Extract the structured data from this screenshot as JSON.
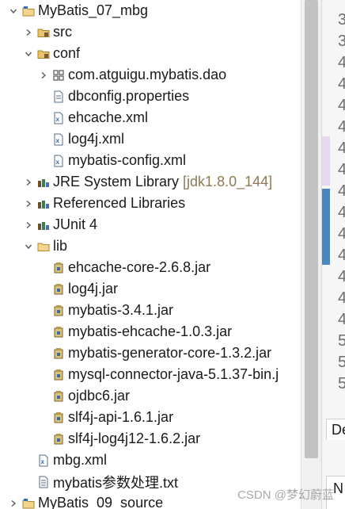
{
  "tree": [
    {
      "label": "MyBatis_07_mbg",
      "icon": "project-icon",
      "toggle": "expanded",
      "depth": 0
    },
    {
      "label": "src",
      "icon": "source-folder-icon",
      "toggle": "collapsed",
      "depth": 1
    },
    {
      "label": "conf",
      "icon": "source-folder-icon",
      "toggle": "expanded",
      "depth": 1
    },
    {
      "label": "com.atguigu.mybatis.dao",
      "icon": "package-icon",
      "toggle": "collapsed",
      "depth": 2
    },
    {
      "label": "dbconfig.properties",
      "icon": "properties-file-icon",
      "toggle": "none",
      "depth": 2
    },
    {
      "label": "ehcache.xml",
      "icon": "xml-file-icon",
      "toggle": "none",
      "depth": 2
    },
    {
      "label": "log4j.xml",
      "icon": "xml-file-icon",
      "toggle": "none",
      "depth": 2
    },
    {
      "label": "mybatis-config.xml",
      "icon": "xml-file-icon",
      "toggle": "none",
      "depth": 2
    },
    {
      "label": "JRE System Library",
      "decoration": "[jdk1.8.0_144]",
      "icon": "library-icon",
      "toggle": "collapsed",
      "depth": 1
    },
    {
      "label": "Referenced Libraries",
      "icon": "library-icon",
      "toggle": "collapsed",
      "depth": 1
    },
    {
      "label": "JUnit 4",
      "icon": "library-icon",
      "toggle": "collapsed",
      "depth": 1
    },
    {
      "label": "lib",
      "icon": "folder-icon",
      "toggle": "expanded",
      "depth": 1
    },
    {
      "label": "ehcache-core-2.6.8.jar",
      "icon": "jar-icon",
      "toggle": "none",
      "depth": 2
    },
    {
      "label": "log4j.jar",
      "icon": "jar-icon",
      "toggle": "none",
      "depth": 2
    },
    {
      "label": "mybatis-3.4.1.jar",
      "icon": "jar-icon",
      "toggle": "none",
      "depth": 2
    },
    {
      "label": "mybatis-ehcache-1.0.3.jar",
      "icon": "jar-icon",
      "toggle": "none",
      "depth": 2
    },
    {
      "label": "mybatis-generator-core-1.3.2.jar",
      "icon": "jar-icon",
      "toggle": "none",
      "depth": 2
    },
    {
      "label": "mysql-connector-java-5.1.37-bin.j",
      "icon": "jar-icon",
      "toggle": "none",
      "depth": 2
    },
    {
      "label": "ojdbc6.jar",
      "icon": "jar-icon",
      "toggle": "none",
      "depth": 2
    },
    {
      "label": "slf4j-api-1.6.1.jar",
      "icon": "jar-icon",
      "toggle": "none",
      "depth": 2
    },
    {
      "label": "slf4j-log4j12-1.6.2.jar",
      "icon": "jar-icon",
      "toggle": "none",
      "depth": 2
    },
    {
      "label": "mbg.xml",
      "icon": "xml-file-icon",
      "toggle": "none",
      "depth": 1
    },
    {
      "label": "mybatis参数处理.txt",
      "icon": "text-file-icon",
      "toggle": "none",
      "depth": 1
    },
    {
      "label": "MyBatis_09_source",
      "icon": "project-icon",
      "toggle": "collapsed",
      "depth": 0
    }
  ],
  "editor": {
    "line_numbers": [
      "3",
      "3",
      "4",
      "4",
      "4",
      "4",
      "4",
      "4",
      "4",
      "4",
      "4",
      "4",
      "4",
      "4",
      "4",
      "5",
      "5",
      "5"
    ],
    "bottom_tab_label": "De",
    "bottom_tab2_label": "N"
  },
  "watermark": "CSDN @梦幻蔚蓝",
  "colors": {
    "decoration": "#8d7a55",
    "highlight_band": "#e6d9ef",
    "change_band": "#4a86c0"
  }
}
